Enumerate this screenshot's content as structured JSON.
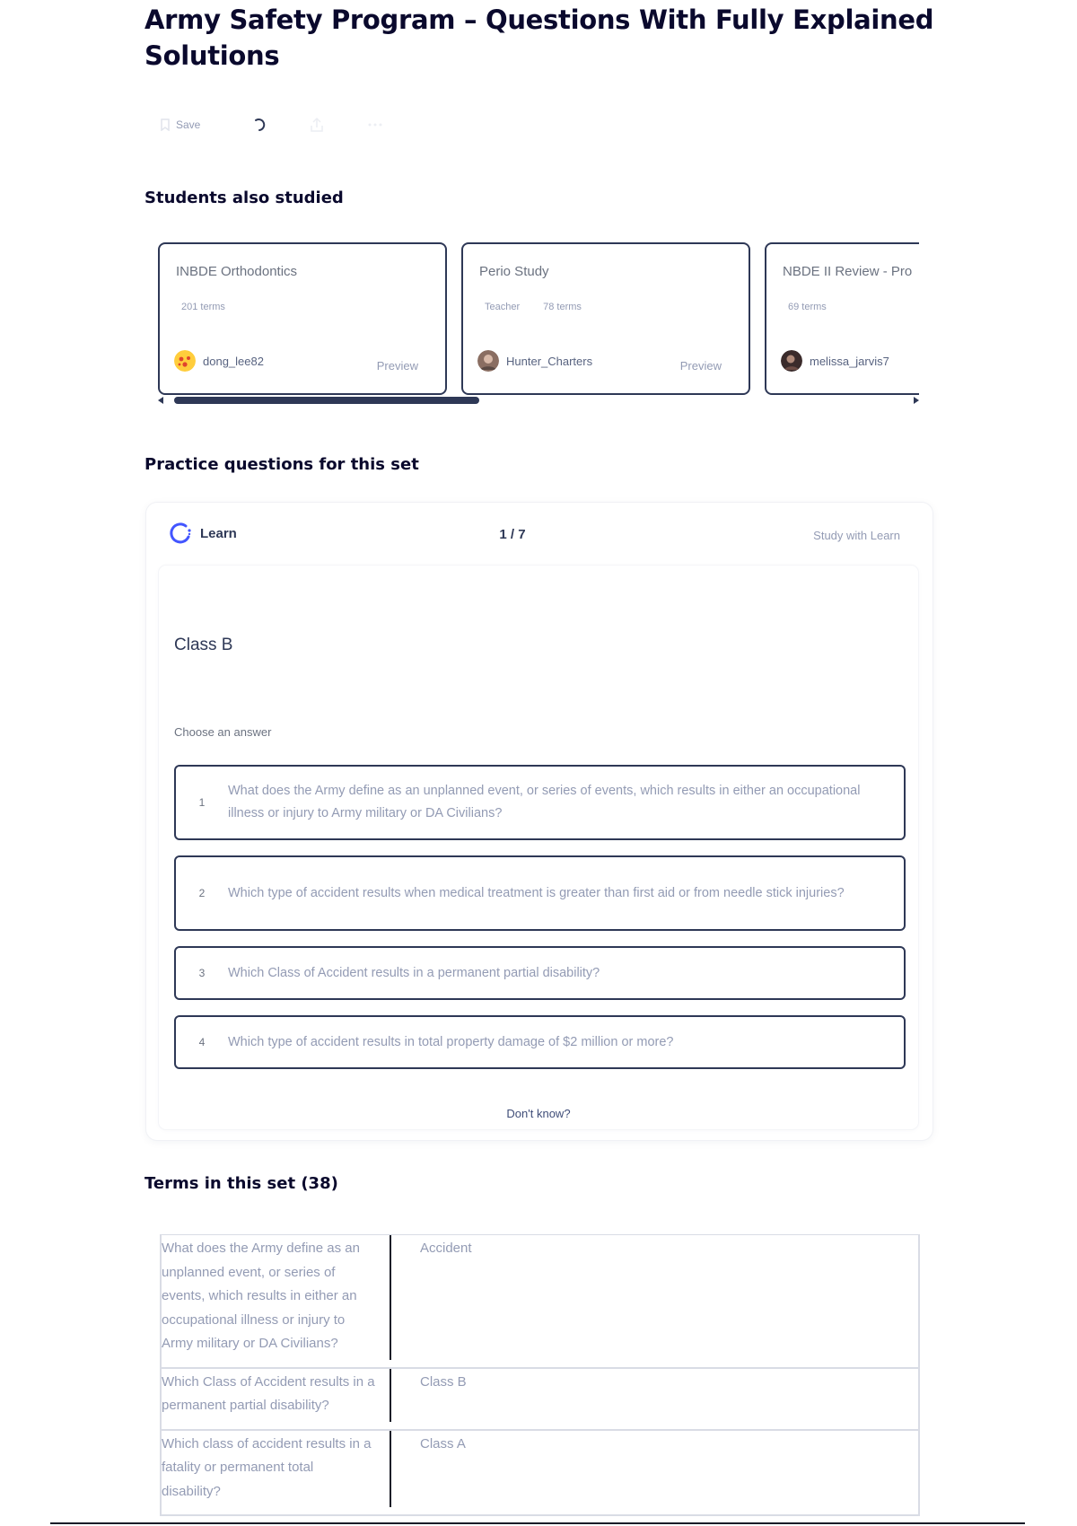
{
  "page": {
    "title": "Army Safety Program – Questions With Fully Explained Solutions"
  },
  "actions": {
    "save_label": "Save"
  },
  "students_also_studied": {
    "heading": "Students also studied",
    "cards": [
      {
        "title": "INBDE Orthodontics",
        "teacher": "",
        "terms": "201 terms",
        "author": "dong_lee82",
        "preview": "Preview"
      },
      {
        "title": "Perio Study",
        "teacher": "Teacher",
        "terms": "78 terms",
        "author": "Hunter_Charters",
        "preview": "Preview"
      },
      {
        "title": "NBDE II Review - Pro",
        "teacher": "",
        "terms": "69 terms",
        "author": "melissa_jarvis7",
        "preview": ""
      }
    ]
  },
  "practice": {
    "heading": "Practice questions for this set",
    "brand": "Learn",
    "progress": "1 / 7",
    "study_link": "Study with Learn",
    "prompt": "Class B",
    "choose_label": "Choose an answer",
    "options": [
      {
        "num": "1",
        "text": "What does the Army define as an unplanned event, or series of events, which results in either an occupational illness or injury to Army military or DA Civilians?"
      },
      {
        "num": "2",
        "text": "Which type of accident results when medical treatment is greater than first aid or from needle stick injuries?"
      },
      {
        "num": "3",
        "text": "Which Class of Accident results in a permanent partial disability?"
      },
      {
        "num": "4",
        "text": "Which type of accident results in total property damage of $2 million or more?"
      }
    ],
    "dont_know": "Don't know?"
  },
  "terms": {
    "heading": "Terms in this set (38)",
    "rows": [
      {
        "term": "What does the Army define as an unplanned event, or series of events, which results in either an occupational illness or injury to Army military or DA Civilians?",
        "definition": "Accident"
      },
      {
        "term": "Which Class of Accident results in a permanent partial disability?",
        "definition": "Class B"
      },
      {
        "term": "Which class of accident results in a fatality or permanent total disability?",
        "definition": "Class A"
      }
    ]
  },
  "colors": {
    "heading": "#0a092d",
    "border": "#2e3856",
    "muted": "#939bb4",
    "accent": "#4255ff"
  },
  "icons": [
    "save-icon",
    "loading-spinner-icon",
    "share-icon",
    "more-icon",
    "learn-icon",
    "chevron-left-icon",
    "chevron-right-icon"
  ]
}
